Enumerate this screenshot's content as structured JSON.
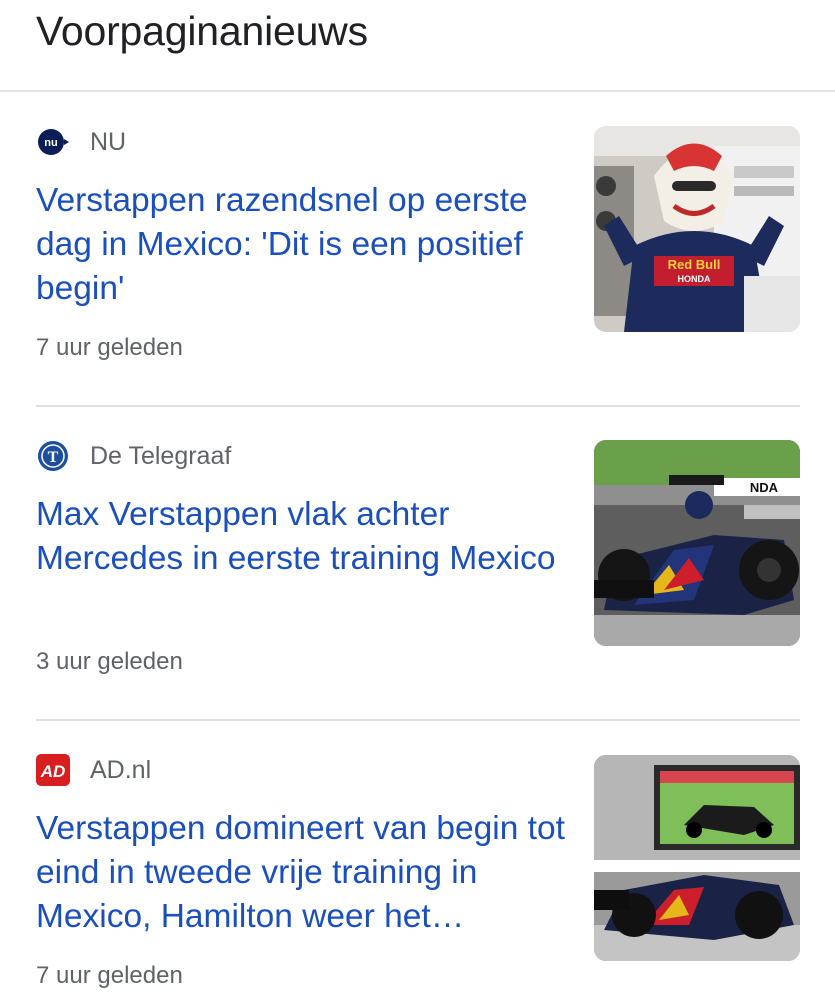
{
  "header": {
    "title": "Voorpaginanieuws"
  },
  "articles": [
    {
      "source": "NU",
      "source_icon": "nu-logo-icon",
      "source_icon_text": "nu",
      "headline": "Verstappen razendsnel op eerste dag in Mexico: 'Dit is een positief begin'",
      "time": "7 uur geleden",
      "thumbnail": "driver-in-mexican-mask-image",
      "thumbnail_text": [
        "Red Bull",
        "HONDA"
      ]
    },
    {
      "source": "De Telegraaf",
      "source_icon": "telegraaf-logo-icon",
      "source_icon_text": "T",
      "headline": "Max Verstappen vlak achter Mercedes in eerste training Mexico",
      "time": "3 uur geleden",
      "thumbnail": "red-bull-f1-car-image",
      "thumbnail_text": [
        "NDA"
      ]
    },
    {
      "source": "AD.nl",
      "source_icon": "ad-logo-icon",
      "source_icon_text": "AD",
      "headline": "Verstappen domineert van begin tot eind in tweede vrije training in Mexico, Hamilton weer het…",
      "time": "7 uur geleden",
      "thumbnail": "f1-cars-on-track-image",
      "thumbnail_text": []
    }
  ],
  "colors": {
    "headline": "#1a4fbc",
    "meta": "#5f6368",
    "title": "#202124",
    "ad_red": "#d81e1e",
    "telegraaf_blue": "#1d4f9c"
  }
}
